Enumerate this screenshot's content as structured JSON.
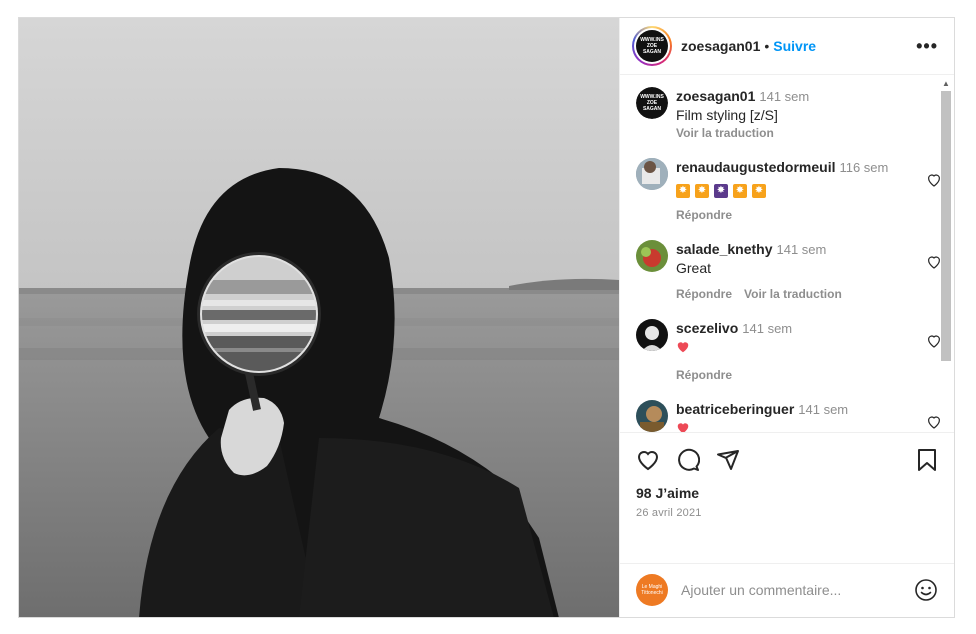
{
  "header": {
    "username": "zoesagan01",
    "separator": "•",
    "follow_label": "Suivre",
    "more_label": "•••",
    "avatar_lines": [
      "WWW.INS",
      "ZOE",
      "SAGAN"
    ]
  },
  "caption": {
    "username": "zoesagan01",
    "time": "141 sem",
    "text": "Film styling [z/S]",
    "translate_label": "Voir la traduction"
  },
  "comments": [
    {
      "username": "renaudaugustedormeuil",
      "time": "116 sem",
      "text": "",
      "reply_label": "Répondre",
      "translate_label": ""
    },
    {
      "username": "salade_knethy",
      "time": "141 sem",
      "text": "Great",
      "reply_label": "Répondre",
      "translate_label": "Voir la traduction"
    },
    {
      "username": "scezelivo",
      "time": "141 sem",
      "text": "",
      "reply_label": "Répondre",
      "translate_label": ""
    },
    {
      "username": "beatriceberinguer",
      "time": "141 sem",
      "text": "",
      "reply_label": "",
      "translate_label": ""
    }
  ],
  "likes_text": "98 J’aime",
  "date_text": "26 avril 2021",
  "add_comment": {
    "placeholder": "Ajouter un commentaire...",
    "avatar_text": "Le Maghi Tittonechi"
  },
  "colors": {
    "link_blue": "#0095f6",
    "muted_gray": "#8e8e8e",
    "heart_red": "#ed4956",
    "emoji_orange": "#f7a21b",
    "emoji_purple": "#5b3a8c"
  },
  "icons": [
    "heart-icon",
    "comment-icon",
    "share-icon",
    "bookmark-icon",
    "emoji-icon",
    "more-icon"
  ]
}
